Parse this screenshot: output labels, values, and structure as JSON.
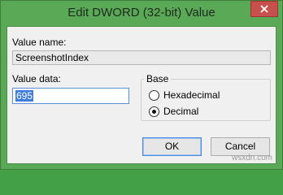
{
  "window": {
    "title": "Edit DWORD (32-bit) Value"
  },
  "icons": {
    "close": "close-icon"
  },
  "value_name": {
    "label": "Value name:",
    "value": "ScreenshotIndex"
  },
  "value_data": {
    "label": "Value data:",
    "value": "695"
  },
  "base": {
    "title": "Base",
    "options": [
      {
        "label": "Hexadecimal",
        "checked": false
      },
      {
        "label": "Decimal",
        "checked": true
      }
    ]
  },
  "buttons": {
    "ok": "OK",
    "cancel": "Cancel"
  },
  "watermark": "wsxdn.com"
}
